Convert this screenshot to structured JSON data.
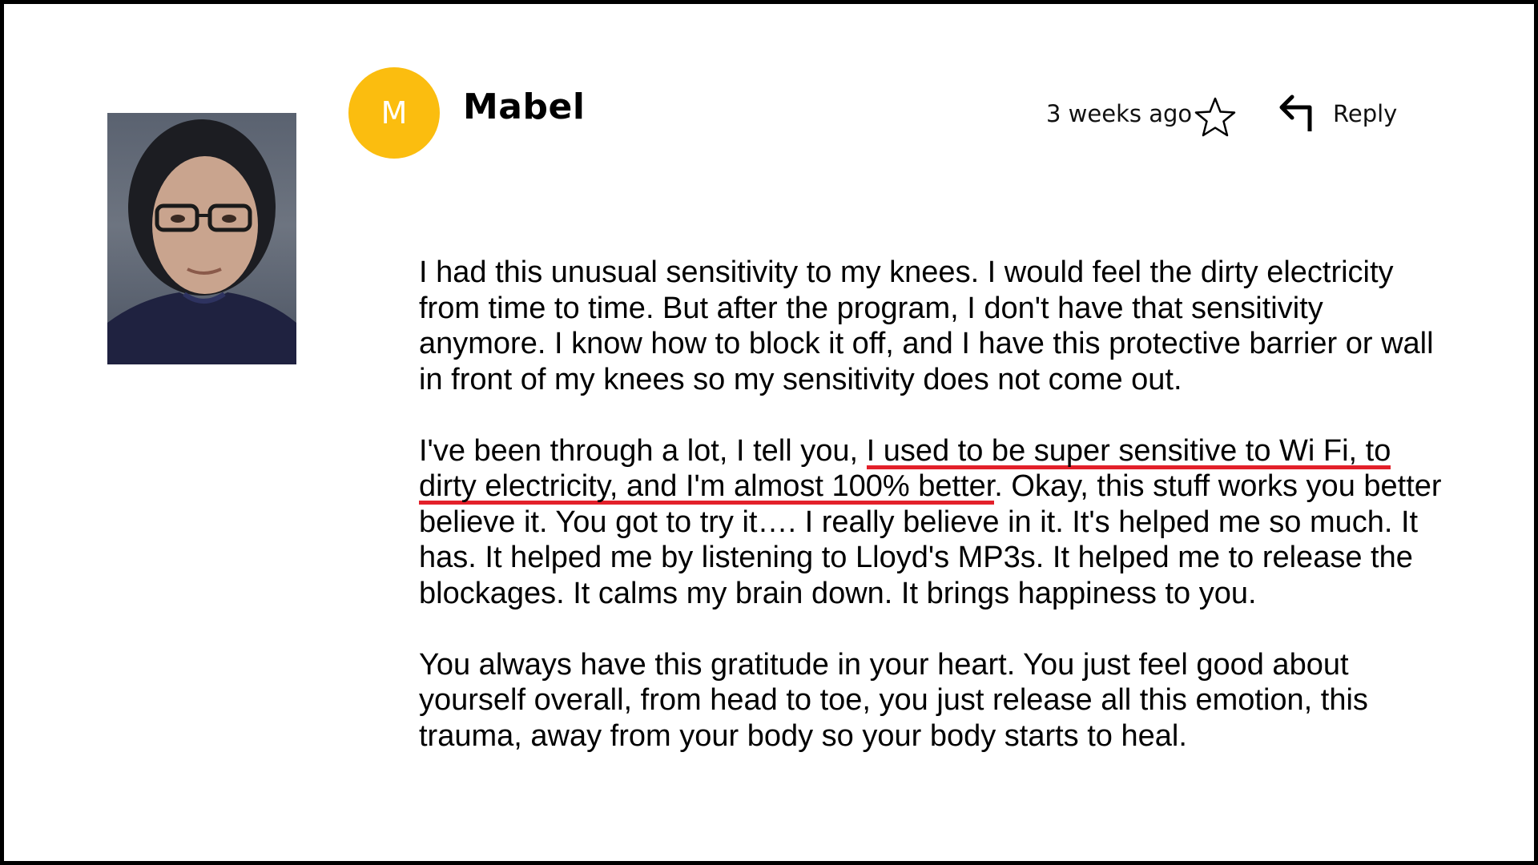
{
  "author": {
    "initial": "M",
    "name": "Mabel",
    "avatar_color": "#fbbd0f"
  },
  "meta": {
    "timestamp": "3 weeks ago",
    "star_icon": "star-outline-icon",
    "reply_icon": "reply-arrow-icon",
    "reply_label": "Reply"
  },
  "photo": {
    "description_icon": "reviewer-photo"
  },
  "comment": {
    "p1": "I had this unusual sensitivity to my knees. I would feel the dirty electricity from time to time. But after the program, I don't have that sensitivity anymore. I know how to block it off, and I have this protective barrier or wall in front of my knees so my sensitivity does not come out.",
    "p2_before": "I've been through a lot, I tell you, ",
    "p2_highlight": "I used to be super sensitive to Wi Fi, to dirty electricity, and I'm almost 100% better",
    "p2_after": ". Okay, this stuff works you better believe it. You got to try it…. I really believe in it. It's helped me so much. It has. It helped me by listening to Lloyd's MP3s. It helped me to release the blockages. It calms my brain down. It brings happiness to you.",
    "p3": "You always have this gratitude in your heart. You just feel good about yourself overall, from head to toe, you just release all this emotion, this trauma, away from your body so your body starts to heal.",
    "highlight_color": "#e3202a"
  }
}
